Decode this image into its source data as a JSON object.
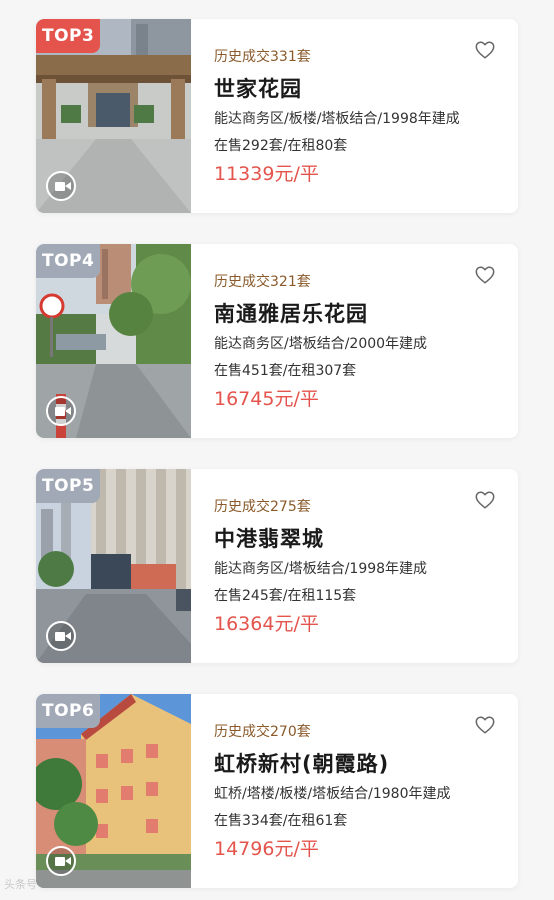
{
  "listings": [
    {
      "rank": "TOP3",
      "deals": "历史成交331套",
      "name": "世家花园",
      "meta": "能达商务区/板楼/塔板结合/1998年建成",
      "stock": "在售292套/在租80套",
      "price": "11339元/平",
      "favorite": false
    },
    {
      "rank": "TOP4",
      "deals": "历史成交321套",
      "name": "南通雅居乐花园",
      "meta": "能达商务区/塔板结合/2000年建成",
      "stock": "在售451套/在租307套",
      "price": "16745元/平",
      "favorite": false
    },
    {
      "rank": "TOP5",
      "deals": "历史成交275套",
      "name": "中港翡翠城",
      "meta": "能达商务区/塔板结合/1998年建成",
      "stock": "在售245套/在租115套",
      "price": "16364元/平",
      "favorite": false
    },
    {
      "rank": "TOP6",
      "deals": "历史成交270套",
      "name": "虹桥新村(朝霞路)",
      "meta": "虹桥/塔楼/板楼/塔板结合/1980年建成",
      "stock": "在售334套/在租61套",
      "price": "14796元/平",
      "favorite": false
    }
  ],
  "icons": {
    "favorite": "heart-outline-icon",
    "video": "video-camera-icon"
  },
  "colors": {
    "price": "#e4544c",
    "deals": "#8a5a2b",
    "top3_badge": "#e4544c",
    "rank_badge": "#a2a9b6"
  },
  "watermark": "头条号"
}
